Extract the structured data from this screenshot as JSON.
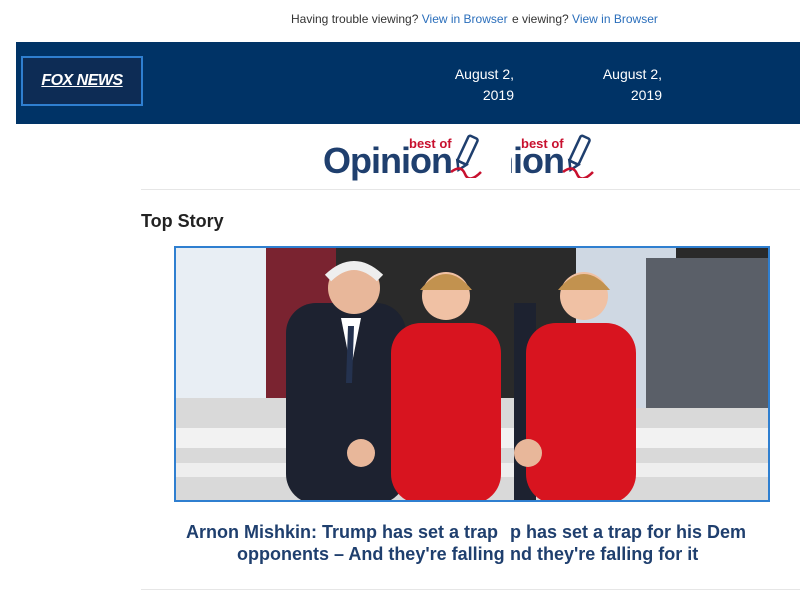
{
  "preheader": {
    "trouble_text": "Having trouble viewing?",
    "view_link": "View in Browser",
    "trouble_text_partial": "e viewing?",
    "view_link_2": "View in Browser"
  },
  "header": {
    "logo_text": "FOX NEWS",
    "date_1": "August 2, 2019",
    "date_2": "August 2, 2019",
    "colors": {
      "bar": "#003366",
      "logo_border": "#2f7fd0"
    }
  },
  "banner": {
    "best_of": "best of",
    "opinion": "Opinion"
  },
  "top_story": {
    "section_label": "Top Story",
    "headline_line1_a": "Arnon Mishkin: Trump has set a trap",
    "headline_line1_b": "p has set a trap for his Dem",
    "headline_line2_a": "opponents – And they're falling",
    "headline_line2_b": "nd they're falling for it",
    "image_icon": "debate-photo"
  }
}
